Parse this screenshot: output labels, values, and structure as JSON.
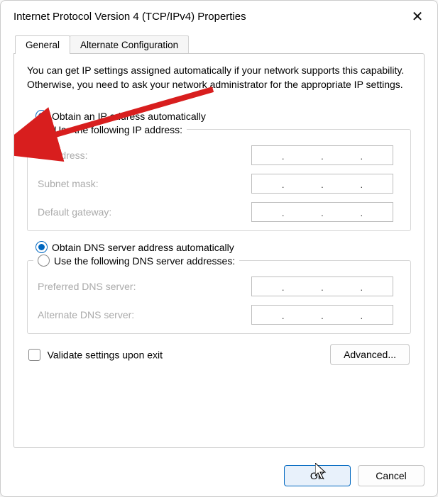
{
  "window": {
    "title": "Internet Protocol Version 4 (TCP/IPv4) Properties"
  },
  "tabs": {
    "general": "General",
    "alternate": "Alternate Configuration"
  },
  "intro": "You can get IP settings assigned automatically if your network supports this capability. Otherwise, you need to ask your network administrator for the appropriate IP settings.",
  "ip": {
    "auto": "Obtain an IP address automatically",
    "manual": "Use the following IP address:",
    "address_label": "IP address:",
    "subnet_label": "Subnet mask:",
    "gateway_label": "Default gateway:"
  },
  "dns": {
    "auto": "Obtain DNS server address automatically",
    "manual": "Use the following DNS server addresses:",
    "preferred_label": "Preferred DNS server:",
    "alternate_label": "Alternate DNS server:"
  },
  "validate_label": "Validate settings upon exit",
  "advanced_label": "Advanced...",
  "ok_label": "OK",
  "cancel_label": "Cancel"
}
